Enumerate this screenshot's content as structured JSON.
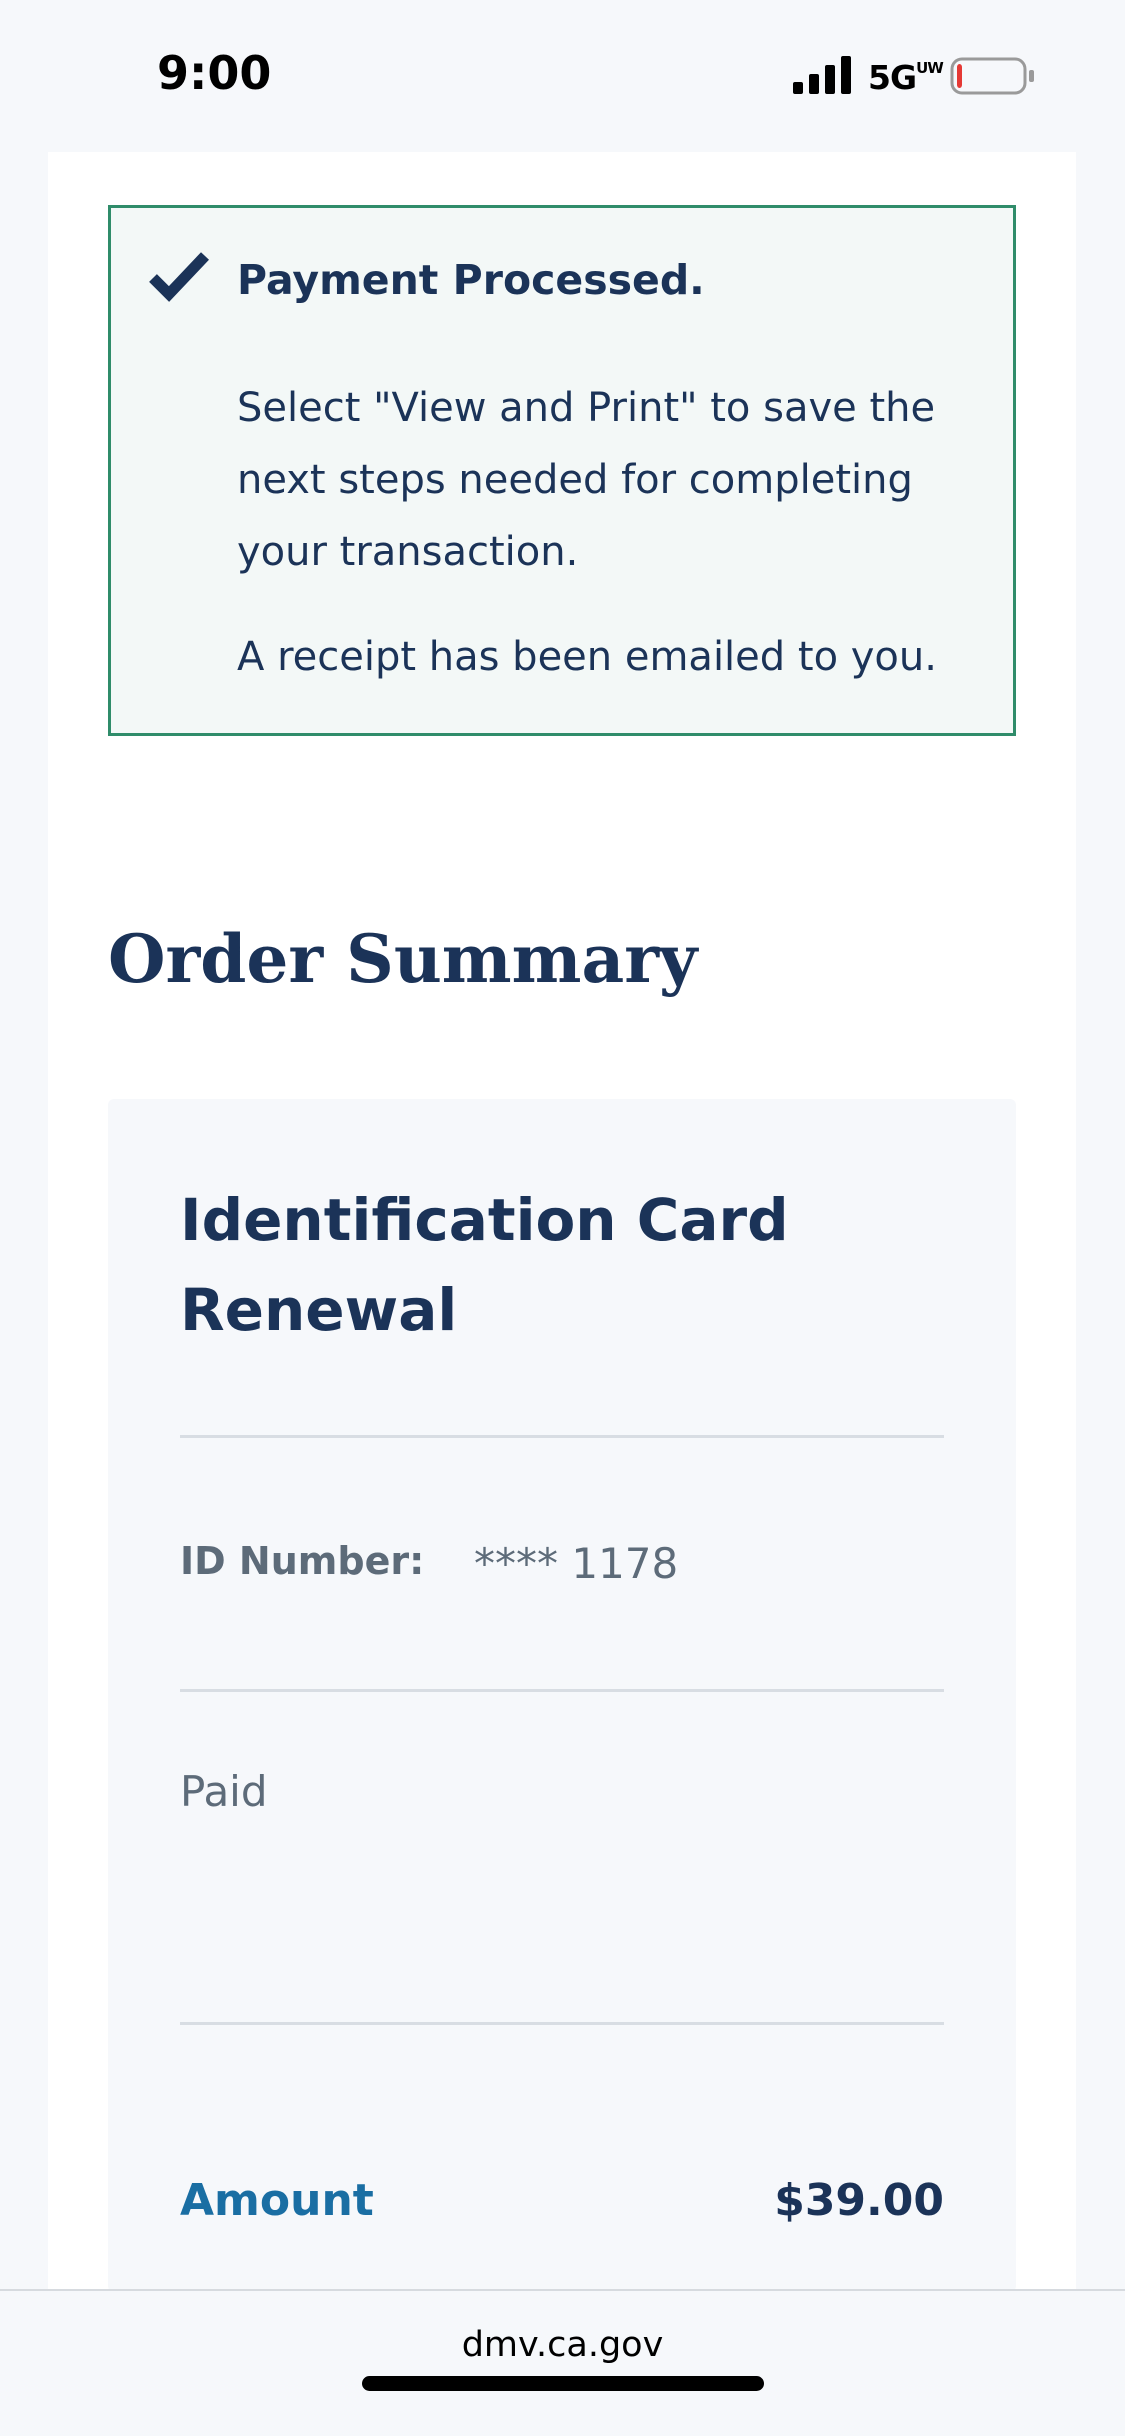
{
  "status_bar": {
    "time": "9:00",
    "network": "5G",
    "network_sup": "UW",
    "battery_level": 0.08
  },
  "alert": {
    "title": "Payment Processed.",
    "body": "Select \"View and Print\" to save the next steps needed for completing your transaction.",
    "receipt": "A receipt has been emailed to you."
  },
  "order": {
    "heading": "Order Summary",
    "card": {
      "title": "Identification Card Renewal",
      "id_label": "ID Number:",
      "id_value": "**** 1178",
      "paid_label": "Paid",
      "amount_label": "Amount",
      "amount_value": "$39.00"
    }
  },
  "browser": {
    "url": "dmv.ca.gov"
  },
  "colors": {
    "navy": "#1b3358",
    "success_border": "#2f8c6a",
    "link_blue": "#1a6ea3",
    "muted": "#5d6b79"
  }
}
